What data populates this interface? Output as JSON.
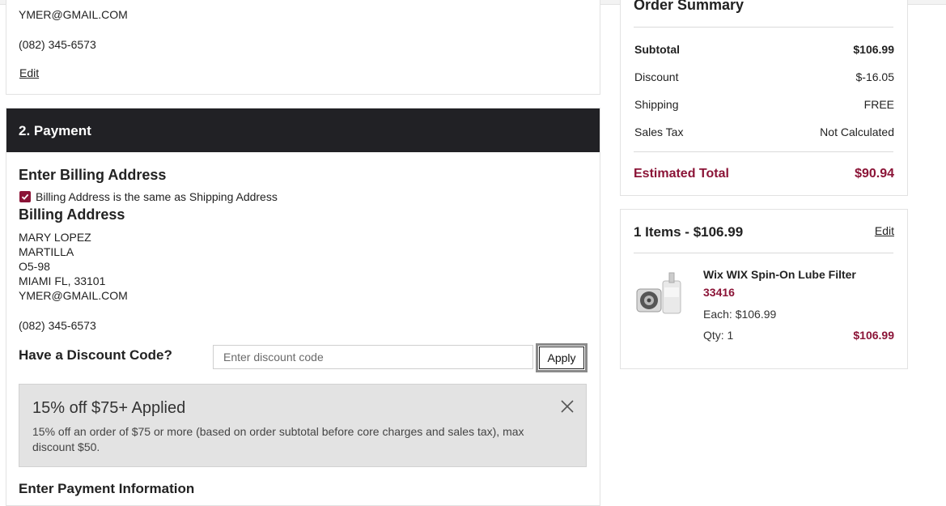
{
  "shipping": {
    "email": "YMER@GMAIL.COM",
    "phone": "(082) 345-6573",
    "edit_label": "Edit"
  },
  "payment": {
    "header": "2. Payment",
    "billing_heading": "Enter Billing Address",
    "same_as_shipping_label": "Billing Address is the same as Shipping Address",
    "same_as_shipping_checked": true,
    "billing_address_heading": "Billing Address",
    "billing_address": {
      "name": "MARY LOPEZ",
      "line1": "MARTILLA",
      "line2": "O5-98",
      "city_state_zip": "MIAMI FL, 33101",
      "email": "YMER@GMAIL.COM",
      "phone": "(082) 345-6573"
    },
    "discount_heading": "Have a Discount Code?",
    "discount_placeholder": "Enter discount code",
    "apply_label": "Apply",
    "promo": {
      "title": "15% off $75+ Applied",
      "description": "15% off an order of $75 or more (based on order subtotal before core charges and sales tax), max discount $50."
    },
    "payment_info_heading": "Enter Payment Information"
  },
  "summary": {
    "title": "Order Summary",
    "rows": [
      {
        "label": "Subtotal",
        "value": "$106.99"
      },
      {
        "label": "Discount",
        "value": "$-16.05"
      },
      {
        "label": "Shipping",
        "value": "FREE"
      },
      {
        "label": "Sales Tax",
        "value": "Not Calculated"
      }
    ],
    "total_label": "Estimated Total",
    "total_value": "$90.94",
    "accent_color": "#8b1437"
  },
  "items": {
    "heading": "1 Items - $106.99",
    "edit_label": "Edit",
    "product": {
      "name": "Wix WIX Spin-On Lube Filter",
      "part_number": "33416",
      "each": "Each: $106.99",
      "qty": "Qty: 1",
      "price": "$106.99"
    }
  }
}
